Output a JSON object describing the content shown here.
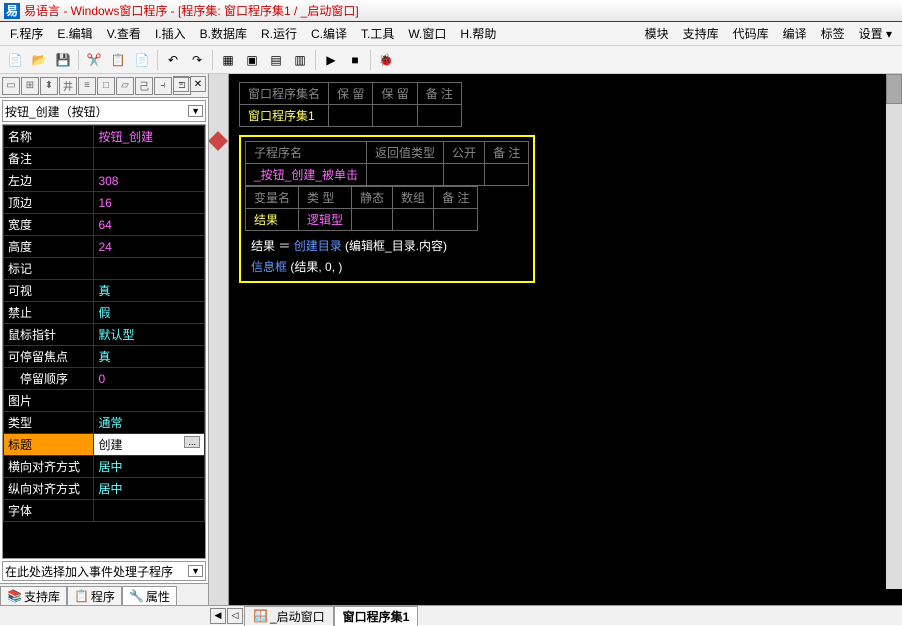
{
  "title": "易语言 - Windows窗口程序 - [程序集: 窗口程序集1 / _启动窗口]",
  "logo": "易",
  "menu": {
    "left": [
      "F.程序",
      "E.编辑",
      "V.查看",
      "I.插入",
      "B.数据库",
      "R.运行",
      "C.编译",
      "T.工具",
      "W.窗口",
      "H.帮助"
    ],
    "right": [
      "模块",
      "支持库",
      "代码库",
      "编译",
      "标签",
      "设置 ▾"
    ]
  },
  "combo": "按钮_创建（按钮）",
  "props": [
    {
      "k": "名称",
      "v": "按钮_创建",
      "cls": "val"
    },
    {
      "k": "备注",
      "v": "",
      "cls": "val"
    },
    {
      "k": "左边",
      "v": "308",
      "cls": "val"
    },
    {
      "k": "顶边",
      "v": "16",
      "cls": "val"
    },
    {
      "k": "宽度",
      "v": "64",
      "cls": "val"
    },
    {
      "k": "高度",
      "v": "24",
      "cls": "val"
    },
    {
      "k": "标记",
      "v": "",
      "cls": "val"
    },
    {
      "k": "可视",
      "v": "真",
      "cls": "val cyan"
    },
    {
      "k": "禁止",
      "v": "假",
      "cls": "val cyan"
    },
    {
      "k": "鼠标指针",
      "v": "默认型",
      "cls": "val cyan"
    },
    {
      "k": "可停留焦点",
      "v": "真",
      "cls": "val cyan"
    },
    {
      "k": "　停留顺序",
      "v": "0",
      "cls": "val"
    },
    {
      "k": "图片",
      "v": "",
      "cls": "val"
    },
    {
      "k": "类型",
      "v": "通常",
      "cls": "val cyan"
    },
    {
      "k": "标题",
      "v": "创建",
      "cls": "val",
      "sel": true,
      "btn": true
    },
    {
      "k": "横向对齐方式",
      "v": "居中",
      "cls": "val cyan"
    },
    {
      "k": "纵向对齐方式",
      "v": "居中",
      "cls": "val cyan"
    },
    {
      "k": "字体",
      "v": "",
      "cls": "val"
    }
  ],
  "eventcombo": "在此处选择加入事件处理子程序",
  "lefttabs": [
    {
      "icon": "📚",
      "label": "支持库"
    },
    {
      "icon": "📋",
      "label": "程序"
    },
    {
      "icon": "🔧",
      "label": "属性",
      "active": true
    }
  ],
  "codetop": {
    "headers": [
      "窗口程序集名",
      "保 留",
      "保 留",
      "备 注"
    ],
    "row": [
      "窗口程序集1",
      "",
      "",
      ""
    ]
  },
  "sub": {
    "headers": [
      "子程序名",
      "返回值类型",
      "公开",
      "备 注"
    ],
    "row": [
      "_按钮_创建_被单击",
      "",
      "",
      ""
    ]
  },
  "vars": {
    "headers": [
      "变量名",
      "类 型",
      "静态",
      "数组",
      "备 注"
    ],
    "row": [
      "结果",
      "逻辑型",
      "",
      "",
      ""
    ]
  },
  "codeline1": {
    "var": "结果",
    "eq": " ＝ ",
    "fn": "创建目录",
    "args": "(编辑框_目录.内容)"
  },
  "codeline2": {
    "fn": "信息框",
    "args": "(结果, 0, )"
  },
  "bottomtabs": [
    {
      "icon": "🪟",
      "label": "_启动窗口"
    },
    {
      "icon": "",
      "label": "窗口程序集1",
      "active": true
    }
  ]
}
